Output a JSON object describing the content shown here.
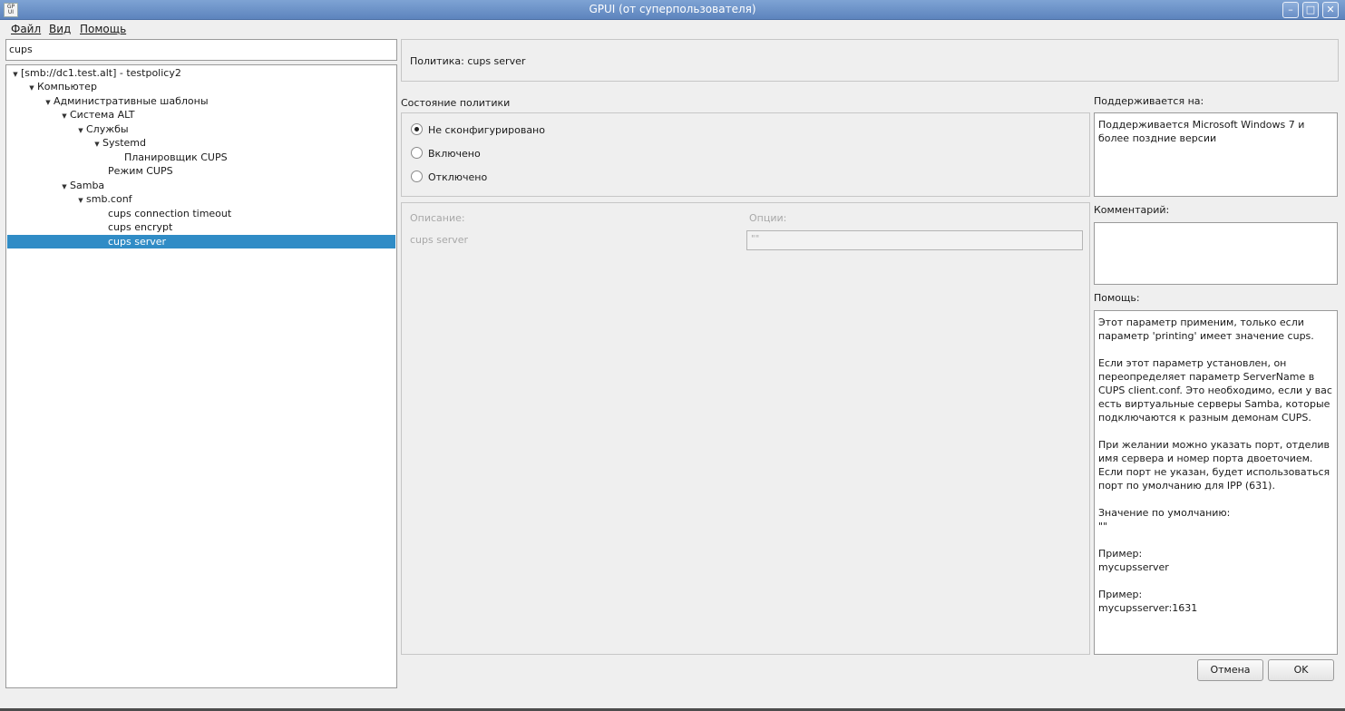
{
  "window": {
    "icon_text": "GP UI",
    "title": "GPUI (от суперпользователя)",
    "controls": {
      "minimize": "–",
      "maximize": "□",
      "close": "✕"
    }
  },
  "menu": [
    "Файл",
    "Вид",
    "Помощь"
  ],
  "filter": {
    "value": "cups"
  },
  "tree": [
    {
      "label": "[smb://dc1.test.alt] - testpolicy2",
      "expanded": true
    },
    {
      "label": "Компьютер",
      "expanded": true
    },
    {
      "label": "Административные шаблоны",
      "expanded": true
    },
    {
      "label": "Система ALT",
      "expanded": true
    },
    {
      "label": "Службы",
      "expanded": true
    },
    {
      "label": "Systemd",
      "expanded": true
    },
    {
      "label": "Планировщик CUPS"
    },
    {
      "label": "Режим CUPS"
    },
    {
      "label": "Samba",
      "expanded": true
    },
    {
      "label": "smb.conf",
      "expanded": true
    },
    {
      "label": "cups connection timeout"
    },
    {
      "label": "cups encrypt"
    },
    {
      "label": "cups server",
      "selected": true
    }
  ],
  "policy": {
    "name": "Политика: cups server"
  },
  "state": {
    "title": "Состояние политики",
    "options": [
      "Не сконфигурировано",
      "Включено",
      "Отключено"
    ],
    "selected": "Не сконфигурировано"
  },
  "options_panel": {
    "description_header": "Описание:",
    "options_header": "Опции:",
    "item_label": "cups server",
    "item_value": "\"\""
  },
  "supported": {
    "label": "Поддерживается на:",
    "text": "Поддерживается Microsoft Windows 7 и более поздние версии"
  },
  "comment": {
    "label": "Комментарий:",
    "text": ""
  },
  "help": {
    "label": "Помощь:",
    "paragraphs": [
      "Этот параметр применим, только если параметр 'printing' имеет значение cups.",
      "Если этот параметр установлен, он переопределяет параметр ServerName в CUPS client.conf. Это необходимо, если у вас есть виртуальные серверы Samba, которые подключаются к разным демонам CUPS.",
      "При желании можно указать порт, отделив имя сервера и номер порта двоеточием. Если порт не указан, будет использоваться порт по умолчанию для IPP (631).",
      "Значение по умолчанию:\n\"\"",
      "Пример:\nmycupsserver",
      "Пример:\nmycupsserver:1631"
    ]
  },
  "buttons": {
    "cancel": "Отмена",
    "ok": "OK"
  },
  "colors": {
    "selection": "#308cc6",
    "titlebar": "#6a8fc6"
  }
}
